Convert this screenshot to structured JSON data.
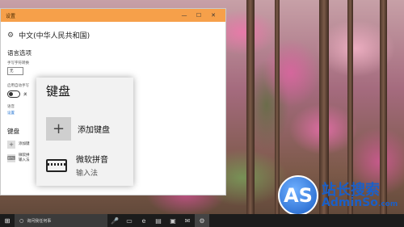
{
  "window": {
    "title": "设置",
    "minimize_glyph": "—",
    "maximize_glyph": "☐",
    "close_glyph": "✕"
  },
  "settings": {
    "page_title": "中文(中华人民共和国)",
    "section_lang_options": "语言选项",
    "handwriting_label": "手写字符转换",
    "handwriting_value": "无",
    "personalize_label": "启用自动手写",
    "toggle_state": "关",
    "voice_label": "语音",
    "settings_link": "设置",
    "section_keyboards": "键盘",
    "add_keyboard_short": "添加键",
    "ime_short": "微软拼",
    "ime_short_sub": "输入法"
  },
  "popup": {
    "title": "键盘",
    "add_label": "添加键盘",
    "ime_name": "微软拼音",
    "ime_type": "输入法"
  },
  "taskbar": {
    "search_placeholder": "询问我任何事"
  },
  "watermark": {
    "badge": "AS",
    "line1": "站长搜索",
    "line2": "AdminSo",
    "tld": ".com"
  }
}
